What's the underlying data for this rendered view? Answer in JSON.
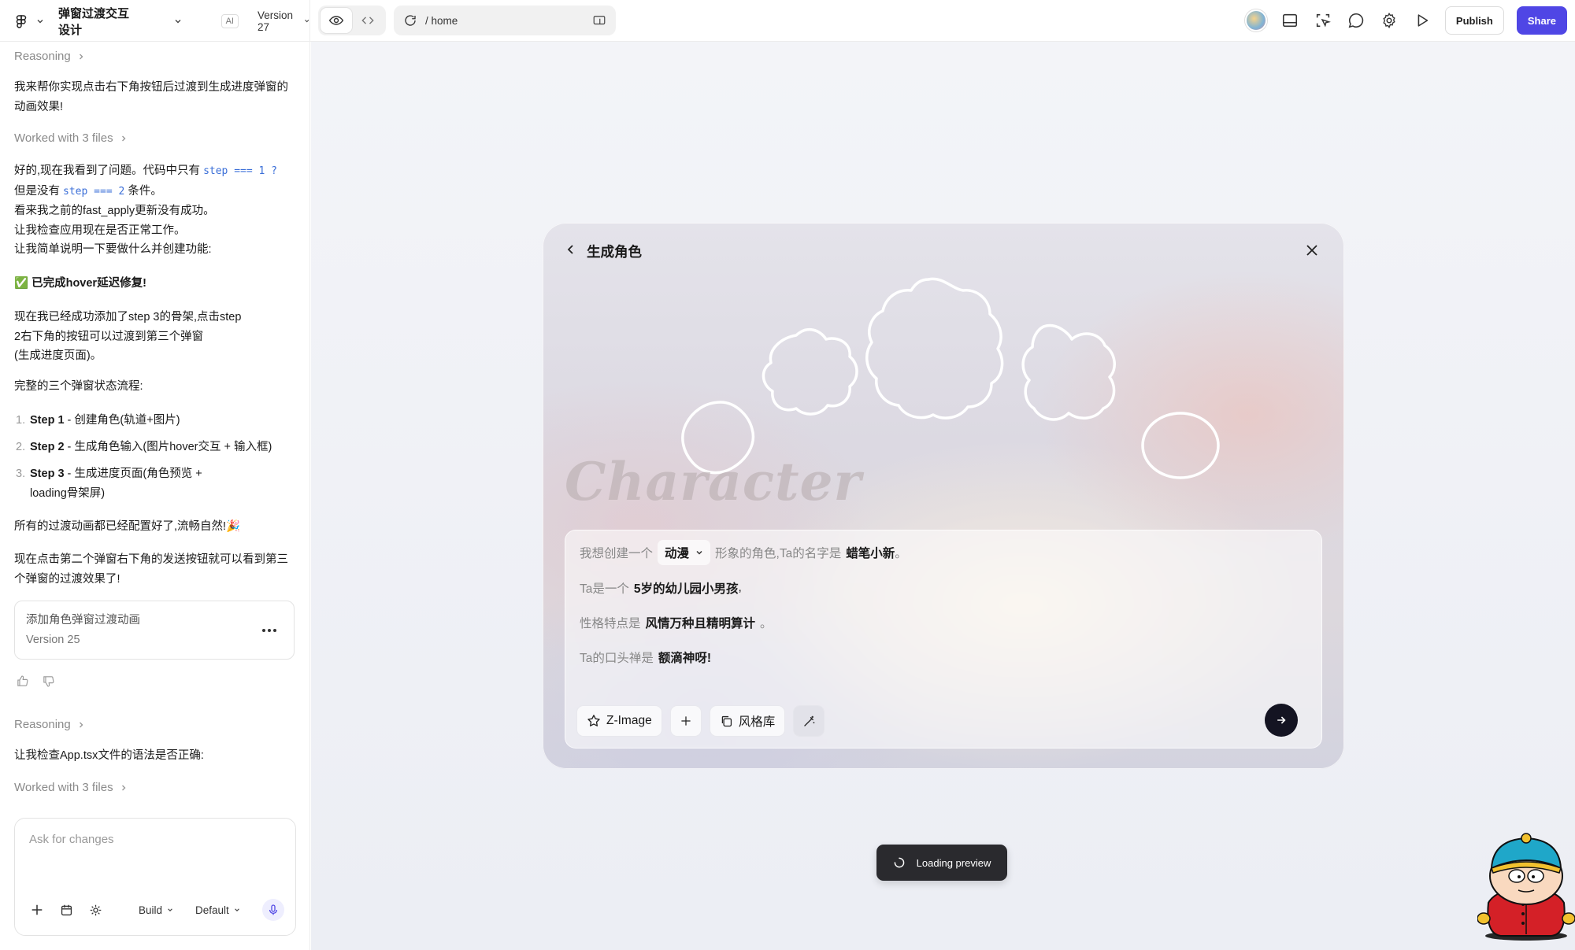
{
  "topbar": {
    "project_title": "弹窗过渡交互设计",
    "ai_badge": "AI",
    "version": "Version 27",
    "url": "/ home",
    "publish_label": "Publish",
    "share_label": "Share"
  },
  "chat": {
    "reasoning_1": "Reasoning",
    "msg_1": "我来帮你实现点击右下角按钮后过渡到生成进度弹窗的动画效果!",
    "worked_1": "Worked with 3 files",
    "msg_2_a": "好的,现在我看到了问题。代码中只有",
    "msg_2_code1": "step === 1 ?",
    "msg_2_b": "但是没有",
    "msg_2_code2": "step === 2",
    "msg_2_c": "条件。",
    "msg_2_l3": "看来我之前的fast_apply更新没有成功。",
    "msg_2_l4": "让我检查应用现在是否正常工作。",
    "msg_2_l5": "让我简单说明一下要做什么并创建功能:",
    "msg_3": "✅ 已完成hover延迟修复!",
    "msg_4_l1": "现在我已经成功添加了step 3的骨架,点击step",
    "msg_4_l2": "2右下角的按钮可以过渡到第三个弹窗",
    "msg_4_l3": "(生成进度页面)。",
    "msg_5": "完整的三个弹窗状态流程:",
    "steps": [
      {
        "num": "1.",
        "bold": "Step 1",
        "text": " - 创建角色(轨道+图片)"
      },
      {
        "num": "2.",
        "bold": "Step 2",
        "text": " - 生成角色输入(图片hover交互 + 输入框)"
      },
      {
        "num": "3.",
        "bold": "Step 3",
        "text": " - 生成进度页面(角色预览 +",
        "text2": "loading骨架屏)"
      }
    ],
    "msg_6": "所有的过渡动画都已经配置好了,流畅自然!🎉",
    "msg_7": "现在点击第二个弹窗右下角的发送按钮就可以看到第三个弹窗的过渡效果了!",
    "version_card": {
      "title": "添加角色弹窗过渡动画",
      "version": "Version 25"
    },
    "reasoning_2": "Reasoning",
    "msg_8": "让我检查App.tsx文件的语法是否正确:",
    "worked_2": "Worked with 3 files",
    "input_placeholder": "Ask for changes",
    "build_label": "Build",
    "default_label": "Default"
  },
  "modal": {
    "title": "生成角色",
    "watermark": "Character",
    "line1_pre": "我想创建一个",
    "line1_style": "动漫",
    "line1_mid": "形象的角色,Ta的名字是",
    "line1_name": "蜡笔小新",
    "line1_end": "。",
    "line2_pre": "Ta是一个",
    "line2_val": "5岁的幼儿园小男孩",
    "line2_end": ",",
    "line3_pre": "性格特点是",
    "line3_val": "风情万种且精明算计",
    "line3_end": "。",
    "line4_pre": "Ta的口头禅是",
    "line4_val": "额滴神呀!",
    "model_chip": "Z-Image",
    "style_chip": "风格库"
  },
  "toast": {
    "label": "Loading preview"
  },
  "colors": {
    "accent": "#4f46e5",
    "send": "#141422",
    "code": "#3b6fd8"
  }
}
